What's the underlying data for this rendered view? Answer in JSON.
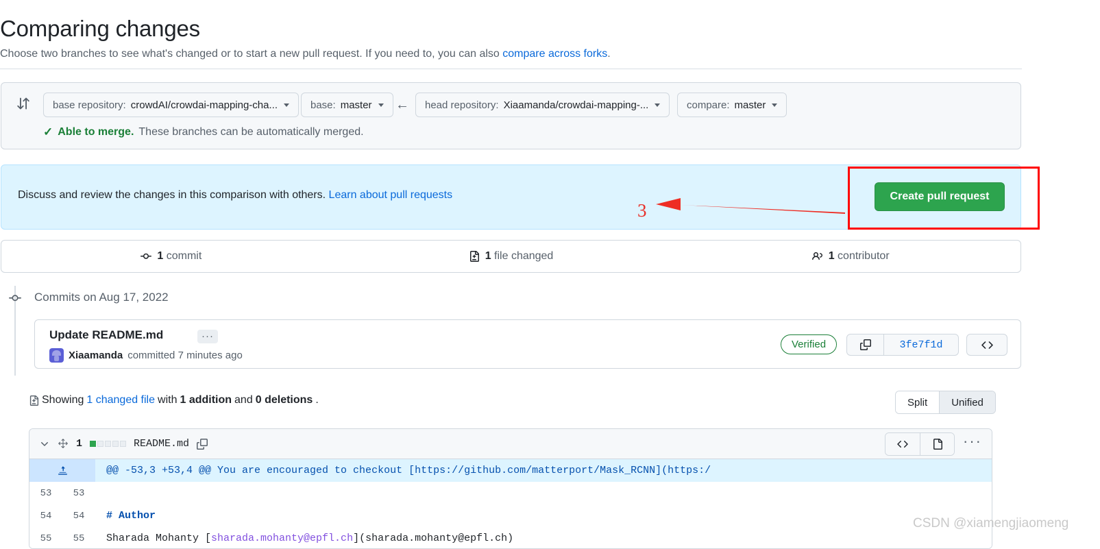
{
  "header": {
    "title": "Comparing changes",
    "subtitle_prefix": "Choose two branches to see what's changed or to start a new pull request. If you need to, you can also ",
    "subtitle_link": "compare across forks",
    "subtitle_suffix": "."
  },
  "compare_form": {
    "swap_icon": "swap-vertical-icon",
    "base_repo": {
      "label": "base repository:",
      "value": "crowdAI/crowdai-mapping-cha..."
    },
    "base_branch": {
      "label": "base:",
      "value": "master"
    },
    "direction_arrow": "←",
    "head_repo": {
      "label": "head repository:",
      "value": "Xiaamanda/crowdai-mapping-..."
    },
    "compare_branch": {
      "label": "compare:",
      "value": "master"
    },
    "merge_status": {
      "check_icon": "✓",
      "strong": "Able to merge.",
      "rest": " These branches can be automatically merged."
    }
  },
  "info_banner": {
    "text": "Discuss and review the changes in this comparison with others. ",
    "link": "Learn about pull requests",
    "create_pr_label": "Create pull request",
    "accent_green": "#2da44e",
    "banner_bg": "#ddf4ff"
  },
  "annotation": {
    "step_number": "3",
    "highlight_color": "#ff0000",
    "arrow_color": "#ee2d24"
  },
  "stats": [
    {
      "icon": "commit-icon",
      "count": "1",
      "label": " commit"
    },
    {
      "icon": "file-diff-icon",
      "count": "1",
      "label": " file changed"
    },
    {
      "icon": "people-icon",
      "count": "1",
      "label": " contributor"
    }
  ],
  "commits": {
    "group_heading": "Commits on Aug 17, 2022",
    "node_icon": "commit-node-icon",
    "entry": {
      "title": "Update README.md",
      "ellipsis": "···",
      "author": "Xiaamanda",
      "meta_text": " committed 7 minutes ago",
      "verified_label": "Verified",
      "copy_icon": "copy-icon",
      "sha": "3fe7f1d",
      "code_icon": "code-icon"
    }
  },
  "files_summary": {
    "diffstat_icon": "file-diff-icon",
    "prefix": "Showing ",
    "changed_file_link": "1 changed file",
    "middle": " with ",
    "additions": "1 addition",
    "conjunction": " and ",
    "deletions": "0 deletions",
    "suffix": ".",
    "view_toggle": {
      "options": [
        "Split",
        "Unified"
      ],
      "selected": "Unified"
    }
  },
  "diff_file": {
    "chevron_icon": "chevron-down-icon",
    "move_icon": "move-icon",
    "change_count": "1",
    "diffstat_squares": [
      "add",
      "none",
      "none",
      "none",
      "none"
    ],
    "filename": "README.md",
    "copy_icon": "copy-icon",
    "actions": {
      "code_icon": "code-icon",
      "file_icon": "file-icon",
      "kebab_icon": "kebab-horizontal-icon"
    },
    "hunk": {
      "expand_icon": "unfold-up-icon",
      "text": "@@ -53,3 +53,4 @@ You are encouraged to checkout [https://github.com/matterport/Mask_RCNN](https:/"
    },
    "rows": [
      {
        "old": "53",
        "new": "53",
        "code": ""
      },
      {
        "old": "54",
        "new": "54",
        "code": "# Author",
        "style": "heading"
      },
      {
        "old": "55",
        "new": "55",
        "code_pre": "Sharada Mohanty [",
        "code_link": "sharada.mohanty@epfl.ch",
        "code_post": "](sharada.mohanty@epfl.ch)",
        "style": "link"
      }
    ]
  },
  "watermark": "CSDN @xiamengjiaomeng"
}
